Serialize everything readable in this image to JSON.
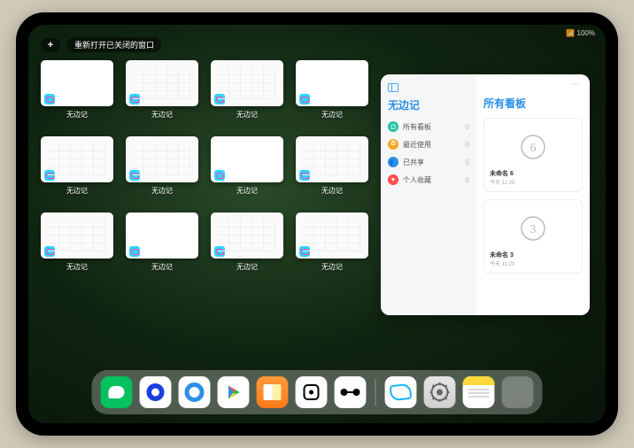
{
  "status": {
    "battery": "100%",
    "wifi": "📶"
  },
  "topbar": {
    "plus": "+",
    "restore_label": "重新打开已关闭的窗口"
  },
  "app_window_label": "无边记",
  "windows": [
    {
      "style": "blank"
    },
    {
      "style": "cal"
    },
    {
      "style": "cal"
    },
    {
      "style": "blank"
    },
    {
      "style": "cal"
    },
    {
      "style": "cal"
    },
    {
      "style": "blank"
    },
    {
      "style": "cal"
    },
    {
      "style": "cal"
    },
    {
      "style": "blank"
    },
    {
      "style": "cal"
    },
    {
      "style": "cal"
    }
  ],
  "panel": {
    "left_title": "无边记",
    "items": [
      {
        "icon_color": "#27c2a0",
        "glyph": "◻",
        "label": "所有看板",
        "count": "0"
      },
      {
        "icon_color": "#f5a623",
        "glyph": "⏱",
        "label": "最近使用",
        "count": "0"
      },
      {
        "icon_color": "#2a8fe6",
        "glyph": "👥",
        "label": "已共享",
        "count": "0"
      },
      {
        "icon_color": "#ff4d4d",
        "glyph": "♥",
        "label": "个人收藏",
        "count": "0"
      }
    ],
    "right_title": "所有看板",
    "more": "⋯",
    "cards": [
      {
        "glyph": "6",
        "title": "未命名 6",
        "sub": "今天 11:25"
      },
      {
        "glyph": "3",
        "title": "未命名 3",
        "sub": "今天 11:20"
      }
    ]
  },
  "dock": {
    "items": [
      {
        "name": "wechat-icon"
      },
      {
        "name": "hd-browser-icon"
      },
      {
        "name": "qq-browser-icon"
      },
      {
        "name": "play-icon"
      },
      {
        "name": "books-icon"
      },
      {
        "name": "dice-icon"
      },
      {
        "name": "connect-icon"
      }
    ],
    "recent": [
      {
        "name": "freeform-icon"
      },
      {
        "name": "settings-icon"
      },
      {
        "name": "notes-icon"
      },
      {
        "name": "app-folder-icon"
      }
    ]
  }
}
